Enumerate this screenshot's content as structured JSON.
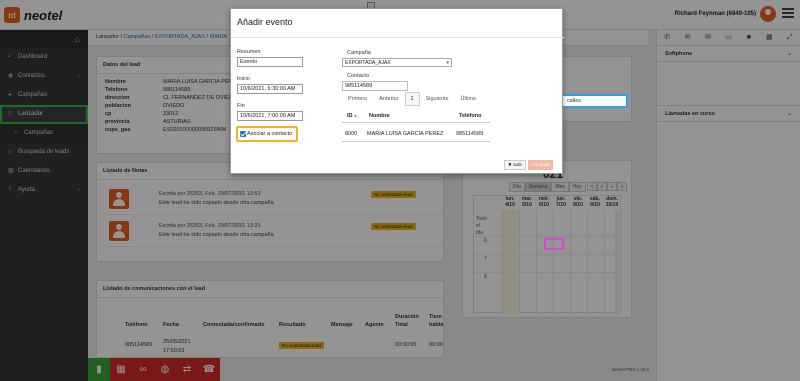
{
  "app": {
    "logo_mark": "nt",
    "logo_text": "neotel",
    "user": "Richard Feynman (6849-105)"
  },
  "breadcrumb": {
    "root": "Lanzador",
    "items": [
      "Campañas",
      "EXPORTADA_AJAX",
      "MARIA"
    ]
  },
  "sidebar": {
    "home_icon": "home-icon",
    "items": [
      {
        "label": "Dashboard",
        "icon": "dashboard-icon"
      },
      {
        "label": "Contactos",
        "icon": "eye-icon",
        "chevron": "›"
      },
      {
        "label": "Campañas",
        "icon": "megaphone-icon"
      },
      {
        "label": "Lanzador",
        "icon": "list-icon",
        "active": true
      },
      {
        "label": "Campañas",
        "icon": "list-icon",
        "sub": true
      },
      {
        "label": "Búsqueda de leads",
        "icon": "search-icon"
      },
      {
        "label": "Calendarios",
        "icon": "calendar-icon"
      },
      {
        "label": "Ayuda",
        "icon": "help-icon",
        "chevron": "›"
      }
    ]
  },
  "lead": {
    "title": "Datos del lead",
    "rows": [
      {
        "k": "Nombre",
        "v": "MARIA LUISA GARCIA PEREZ"
      },
      {
        "k": "Telefono",
        "v": "985114589"
      },
      {
        "k": "direccion",
        "v": "CL FERNANDEZ DE OVIEDO"
      },
      {
        "k": "poblacion",
        "v": "OVIEDO"
      },
      {
        "k": "cp",
        "v": "33012"
      },
      {
        "k": "provincia",
        "v": "ASTURIAS"
      },
      {
        "k": "cups_gas",
        "v": "ES0201000000309Z6WM"
      }
    ]
  },
  "notes": {
    "title": "Listado de Notas",
    "items": [
      {
        "written": "Escrita por 26353, Feb. 29/07/2021 13:53",
        "text": "Este lead ha sido copiado desde otra campaña",
        "badge": "No contestado lead"
      },
      {
        "written": "Escrita por 26353, Feb. 29/07/2021 13:21",
        "text": "Este lead ha sido copiado desde otra campaña",
        "badge": "No contestado lead"
      }
    ]
  },
  "comms": {
    "title": "Listado de comunicaciones con el lead",
    "headers": [
      "Teléfono",
      "Fecha",
      "Contestada/confirmado",
      "Resultado",
      "Mensaje",
      "Agente",
      "Duración Total",
      "Tiem habla"
    ],
    "row": {
      "phone": "985114589",
      "date": "25/05/2021",
      "time": "17:50:53",
      "badge": "No contestado lead",
      "duration": "00:00:05",
      "talk": "00:00"
    }
  },
  "right_panel": {
    "icons": [
      "phone-icon",
      "chat-icon",
      "mail-icon",
      "sms-icon",
      "video-icon",
      "grid-icon",
      "expand-icon"
    ],
    "softphone": "Softphone",
    "calls": "Llamadas en curso",
    "chevron": "⌄"
  },
  "calendar": {
    "title": "021",
    "views": [
      "Día",
      "Semana",
      "Mes",
      "Hoy"
    ],
    "nav": [
      "<",
      ">",
      "«",
      "»"
    ],
    "allday": "Todo el día",
    "days": [
      {
        "d": "lun.",
        "n": "4/10"
      },
      {
        "d": "mar.",
        "n": "5/10"
      },
      {
        "d": "mié.",
        "n": "6/10"
      },
      {
        "d": "jue.",
        "n": "7/10"
      },
      {
        "d": "vie.",
        "n": "8/10"
      },
      {
        "d": "sáb.",
        "n": "9/10"
      },
      {
        "d": "dom.",
        "n": "10/10"
      }
    ],
    "hours": [
      "6",
      "7",
      "8"
    ]
  },
  "calles_text": "calles",
  "footer": "Neotel PBX 1.10.0",
  "bottombar": [
    "bars-icon",
    "calendar-icon",
    "link-icon",
    "chat-icon",
    "transfer-icon",
    "phone-hangup-icon"
  ],
  "modal": {
    "title": "Añadir evento",
    "resumen_label": "Resumen",
    "resumen_value": "Evento",
    "inicio_label": "Inicio",
    "inicio_value": "10/6/2021, 6:30:00 AM",
    "fin_label": "Fin",
    "fin_value": "10/6/2021, 7:00:00 AM",
    "associate_label": "Asociar a contacto",
    "campana_label": "Campaña",
    "campana_value": "EXPORTADA_AJAX",
    "contacto_label": "Contacto",
    "contacto_value": "985114589",
    "pager": [
      "Primero",
      "Anterior",
      "1",
      "Siguiente",
      "Último"
    ],
    "table_headers": [
      "ID",
      "Nombre",
      "Teléfono"
    ],
    "table_row": {
      "id": "8000",
      "name": "MARIA LUISA GARCIA PEREZ",
      "phone": "985114589"
    },
    "salir": "Salir",
    "guardar": "Guardar"
  }
}
